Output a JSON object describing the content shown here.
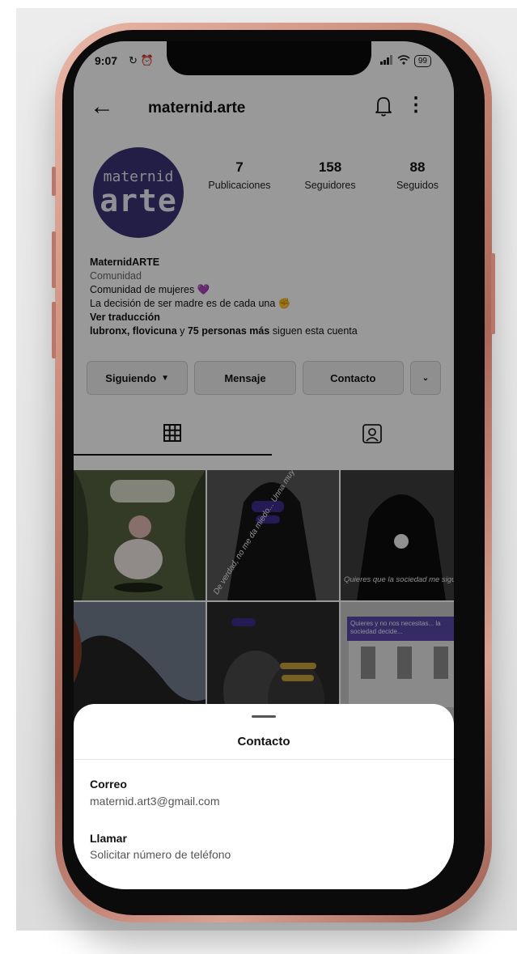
{
  "status": {
    "time": "9:07",
    "status_icons": "↻ ⏰",
    "battery": "99"
  },
  "header": {
    "username": "maternid.arte"
  },
  "profile": {
    "avatar_line1": "maternid",
    "avatar_line2": "arte",
    "stats": [
      {
        "value": "7",
        "label": "Publicaciones"
      },
      {
        "value": "158",
        "label": "Seguidores"
      },
      {
        "value": "88",
        "label": "Seguidos"
      }
    ],
    "name": "MaternidARTE",
    "category": "Comunidad",
    "bio_line1": "Comunidad de mujeres 💜",
    "bio_line2": "La decisión de ser madre es de cada una ✊",
    "translate": "Ver traducción",
    "followed_by_names": "lubronx, flovicuna",
    "followed_by_and": " y ",
    "followed_by_more": "75 personas más",
    "followed_by_tail": " siguen esta cuenta"
  },
  "actions": {
    "following": "Siguiendo",
    "message": "Mensaje",
    "contact": "Contacto"
  },
  "grid_texts": {
    "post2": "De verdad, no me da miedo... Unna muy a dar miedo",
    "post3": "Quieres que la sociedad me sigue... Que vas a quedar sola",
    "post4_caption": "Quieres y no nos necesitas... la sociedad decide..."
  },
  "sheet": {
    "title": "Contacto",
    "email_label": "Correo",
    "email_value": "maternid.art3@gmail.com",
    "call_label": "Llamar",
    "call_value": "Solicitar número de teléfono"
  },
  "colors": {
    "avatar_bg": "#3b3373",
    "frame": "#c98b7a"
  }
}
